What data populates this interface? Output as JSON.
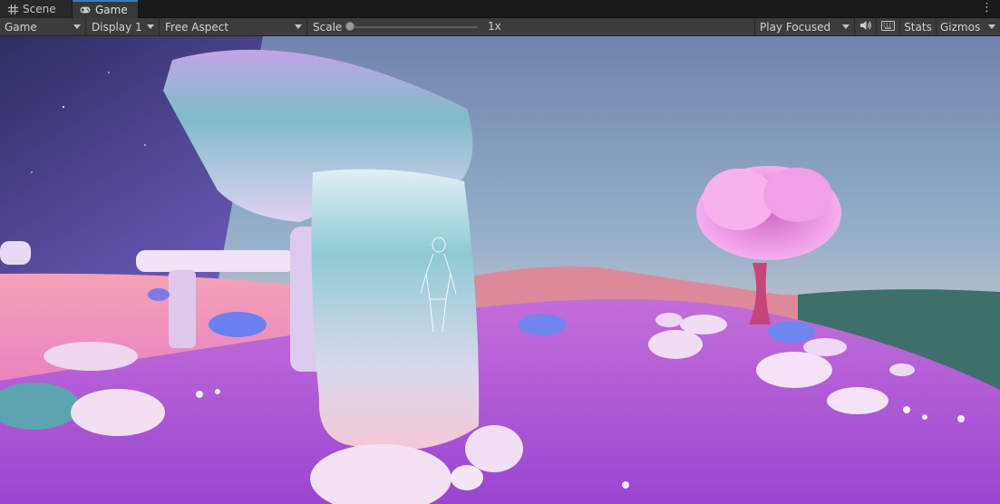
{
  "tabs": [
    {
      "label": "Scene",
      "icon": "grid-icon",
      "active": false
    },
    {
      "label": "Game",
      "icon": "gamepad-icon",
      "active": true
    }
  ],
  "toolbar": {
    "display_type": "Game",
    "display": "Display 1",
    "aspect": "Free Aspect",
    "scale_label": "Scale",
    "scale_value": "1x",
    "play_mode": "Play Focused",
    "stats_label": "Stats",
    "gizmos_label": "Gizmos"
  },
  "colors": {
    "tab_active_accent": "#3a79bb",
    "toolbar_bg": "#3c3c3c",
    "ground_purple": "#a84fd6",
    "stone": "#e6d4f0",
    "tree_pink": "#f08ad8"
  }
}
